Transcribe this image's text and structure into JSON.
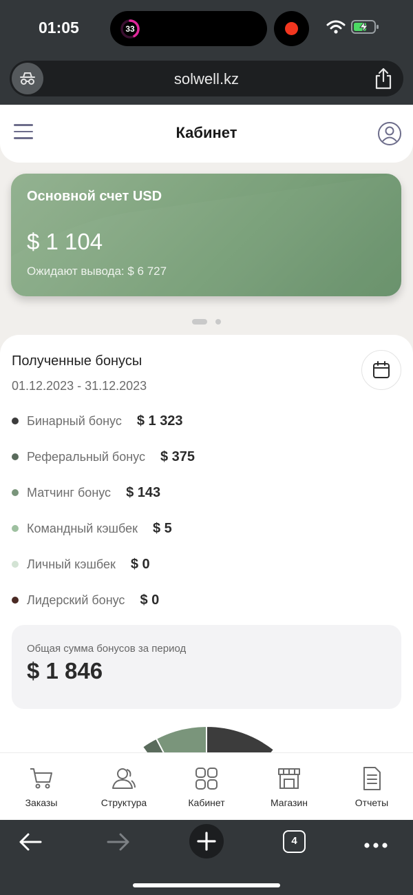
{
  "status_bar": {
    "time": "01:05",
    "activity_count": "33"
  },
  "browser": {
    "url": "solwell.kz",
    "tab_count": "4"
  },
  "header": {
    "title": "Кабинет"
  },
  "account_card": {
    "title": "Основной счет USD",
    "balance": "$ 1 104",
    "pending": "Ожидают вывода: $ 6 727"
  },
  "bonuses": {
    "title": "Полученные бонусы",
    "period": "01.12.2023 - 31.12.2023",
    "items": [
      {
        "label": "Бинарный бонус",
        "value": "$ 1 323",
        "color": "#3c3c3c"
      },
      {
        "label": "Реферальный бонус",
        "value": "$ 375",
        "color": "#5a6b5c"
      },
      {
        "label": "Матчинг бонус",
        "value": "$ 143",
        "color": "#7a957b"
      },
      {
        "label": "Командный кэшбек",
        "value": "$ 5",
        "color": "#9ec0a0"
      },
      {
        "label": "Личный кэшбек",
        "value": "$ 0",
        "color": "#d3e3d4"
      },
      {
        "label": "Лидерский бонус",
        "value": "$ 0",
        "color": "#4a2a24"
      }
    ],
    "total_label": "Общая сумма бонусов за период",
    "total_value": "$ 1 846"
  },
  "bottom_nav": {
    "items": [
      {
        "label": "Заказы",
        "icon": "cart-icon"
      },
      {
        "label": "Структура",
        "icon": "users-icon"
      },
      {
        "label": "Кабинет",
        "icon": "grid-icon"
      },
      {
        "label": "Магазин",
        "icon": "store-icon"
      },
      {
        "label": "Отчеты",
        "icon": "document-icon"
      }
    ]
  }
}
